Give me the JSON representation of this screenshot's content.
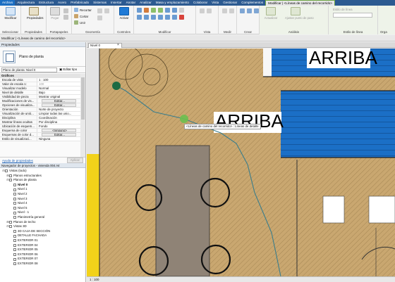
{
  "menu": {
    "tabs": [
      "Archivo",
      "Arquitectura",
      "Estructura",
      "Acero",
      "Prefabricado",
      "Sistemas",
      "Insertar",
      "Anotar",
      "Analizar",
      "Masa y emplazamiento",
      "Colaborar",
      "Vista",
      "Gestionar",
      "Complementos",
      "Modificar | <Líneas de camino del recorrido>"
    ]
  },
  "ribbon": {
    "groups": {
      "select": "Seleccionar",
      "properties": "Propiedades",
      "clipboard": "Portapapeles",
      "geometry": "Geometría",
      "controls": "Controles",
      "modify": "Modificar",
      "view": "Vista",
      "measure": "Medir",
      "create": "Crear",
      "analysis": "Análisis",
      "linestyle": "Estilo de línea",
      "organize": "Orga"
    },
    "buttons": {
      "modify": "Modificar",
      "properties": "Propiedades",
      "paste": "Pegar",
      "cut": "Cortar",
      "join": "Unir",
      "copy": "Recortar",
      "activate": "Activar",
      "create": "Crear",
      "visualize": "Visualizar",
      "route_analysis": "Actualizar",
      "adjust_path": "Ajustar punto de paso",
      "line_style_label": "Estilo de línea"
    }
  },
  "options_bar": {
    "text": "Modificar | <Líneas de camino del recorrido>"
  },
  "properties": {
    "header": "Propiedades",
    "type_name": "Plano de planta",
    "filter_value": "Plano de planta: Nivel 0",
    "edit_type": "Editar tipo",
    "category": "Gráficos",
    "rows": [
      {
        "k": "Escala de vista",
        "v": "1 : 100",
        "g": false
      },
      {
        "k": "Valor de escala   1:",
        "v": "100",
        "g": true
      },
      {
        "k": "Visualizar modelo",
        "v": "Normal",
        "g": false
      },
      {
        "k": "Nivel de detalle",
        "v": "Bajo",
        "g": false
      },
      {
        "k": "Visibilidad de pieza",
        "v": "Mostrar original",
        "g": false
      },
      {
        "k": "Modificaciones de vis...",
        "v": "Editar...",
        "btn": true
      },
      {
        "k": "Opciones de visualiza...",
        "v": "Editar...",
        "btn": true
      },
      {
        "k": "Orientación",
        "v": "Norte de proyecto",
        "g": false
      },
      {
        "k": "Visualización de unió...",
        "v": "Limpiar todas las unio...",
        "g": false
      },
      {
        "k": "Disciplina",
        "v": "Coordinación",
        "g": false
      },
      {
        "k": "Mostrar líneas ocultas",
        "v": "Por disciplina",
        "g": false
      },
      {
        "k": "Ubicación de esquem...",
        "v": "Fondo",
        "g": false
      },
      {
        "k": "Esquema de color",
        "v": "<ninguno>",
        "btn": true
      },
      {
        "k": "Esquemas de color d...",
        "v": "Editar...",
        "btn": true
      },
      {
        "k": "Estilo de visualizaci...",
        "v": "Ninguna",
        "g": false
      }
    ],
    "help_link": "Ayuda de propiedades",
    "apply": "Aplicar"
  },
  "browser": {
    "header": "Navegador de proyectos - vivienda 004.rvt",
    "items": [
      {
        "label": "Vistas (todo)",
        "indent": 0,
        "toggle": "⊟",
        "bold": false
      },
      {
        "label": "Planos estructurales",
        "indent": 1,
        "toggle": "⊞",
        "bold": false
      },
      {
        "label": "Planos de planta",
        "indent": 1,
        "toggle": "⊟",
        "bold": false
      },
      {
        "label": "Nivel 0",
        "indent": 2,
        "toggle": "",
        "bold": true
      },
      {
        "label": "Nivel 1",
        "indent": 2,
        "toggle": "",
        "bold": false
      },
      {
        "label": "Nivel 2",
        "indent": 2,
        "toggle": "",
        "bold": false
      },
      {
        "label": "Nivel 3",
        "indent": 2,
        "toggle": "",
        "bold": false
      },
      {
        "label": "Nivel 4",
        "indent": 2,
        "toggle": "",
        "bold": false
      },
      {
        "label": "Nivel 5",
        "indent": 2,
        "toggle": "",
        "bold": false
      },
      {
        "label": "Nivel - 1",
        "indent": 2,
        "toggle": "",
        "bold": false
      },
      {
        "label": "Planimetría general",
        "indent": 2,
        "toggle": "",
        "bold": false
      },
      {
        "label": "Planos de techo",
        "indent": 1,
        "toggle": "⊞",
        "bold": false
      },
      {
        "label": "Vistas 3D",
        "indent": 1,
        "toggle": "⊟",
        "bold": false
      },
      {
        "label": "3D CAJA DE SECCIÓN",
        "indent": 2,
        "toggle": "",
        "bold": false
      },
      {
        "label": "DETALLE FACHADA",
        "indent": 2,
        "toggle": "",
        "bold": false
      },
      {
        "label": "EXTERIOR 01",
        "indent": 2,
        "toggle": "",
        "bold": false
      },
      {
        "label": "EXTERIOR 04",
        "indent": 2,
        "toggle": "",
        "bold": false
      },
      {
        "label": "EXTERIOR 05",
        "indent": 2,
        "toggle": "",
        "bold": false
      },
      {
        "label": "EXTERIOR 06",
        "indent": 2,
        "toggle": "",
        "bold": false
      },
      {
        "label": "EXTERIOR 07",
        "indent": 2,
        "toggle": "",
        "bold": false
      },
      {
        "label": "EXTERIOR 08",
        "indent": 2,
        "toggle": "",
        "bold": false
      }
    ]
  },
  "view": {
    "tab_label": "Nivel 0",
    "close": "×",
    "annotation_text_1": "ARRIBA",
    "annotation_text_2": "ARRIBA",
    "tooltip": "<Líneas de camino del recorrido> : Líneas de detalle",
    "scale": "1 : 100",
    "colors": {
      "floor": "#c9a770",
      "stairs": "#1b6fc6",
      "path": "#3a7d8c",
      "node": "#2b8a4b"
    }
  }
}
